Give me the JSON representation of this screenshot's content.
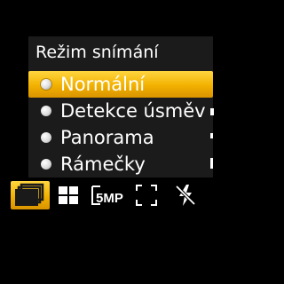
{
  "menu": {
    "title": "Režim snímání",
    "items": [
      {
        "label": "Normální",
        "selected": true
      },
      {
        "label": "Detekce úsměv",
        "selected": false
      },
      {
        "label": "Panorama",
        "selected": false
      },
      {
        "label": "Rámečky",
        "selected": false
      }
    ]
  },
  "toolbar": {
    "resolution_label": "5MP",
    "icons": [
      "shooting-mode-icon",
      "grid-icon",
      "resolution-5mp-icon",
      "focus-frame-icon",
      "flash-off-icon"
    ]
  },
  "colors": {
    "highlight": "#f2b100",
    "panel": "#1b1b1b",
    "background": "#000000",
    "text": "#ffffff"
  }
}
